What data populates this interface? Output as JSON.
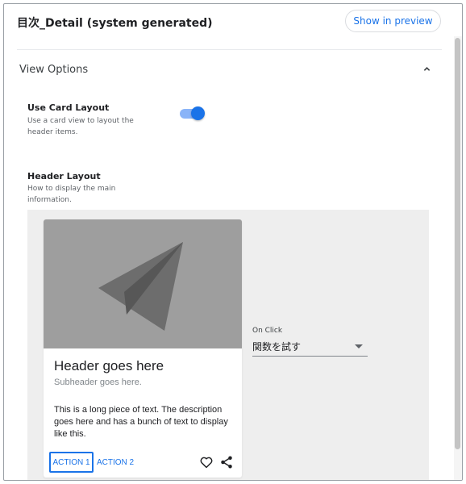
{
  "header": {
    "title": "目次_Detail (system generated)",
    "preview_button": "Show in preview"
  },
  "view_options": {
    "title": "View Options",
    "expanded": true,
    "use_card_layout": {
      "label": "Use Card Layout",
      "description": "Use a card view to layout the header items.",
      "enabled": true
    },
    "header_layout": {
      "label": "Header Layout",
      "description": "How to display the main information."
    }
  },
  "card_preview": {
    "media_icon": "send-paper-plane-icon",
    "title": "Header goes here",
    "subheader": "Subheader goes here.",
    "body": "This is a long piece of text. The description goes here and has a bunch of text to display like this.",
    "actions": [
      "ACTION 1",
      "ACTION 2"
    ],
    "icons": [
      "heart-icon",
      "share-icon"
    ]
  },
  "on_click": {
    "label": "On Click",
    "value": "関数を試す"
  },
  "colors": {
    "accent": "#1a73e8",
    "toggle_track": "#8ab4f8",
    "preview_bg": "#eeeeee",
    "media_bg": "#9e9e9e"
  }
}
